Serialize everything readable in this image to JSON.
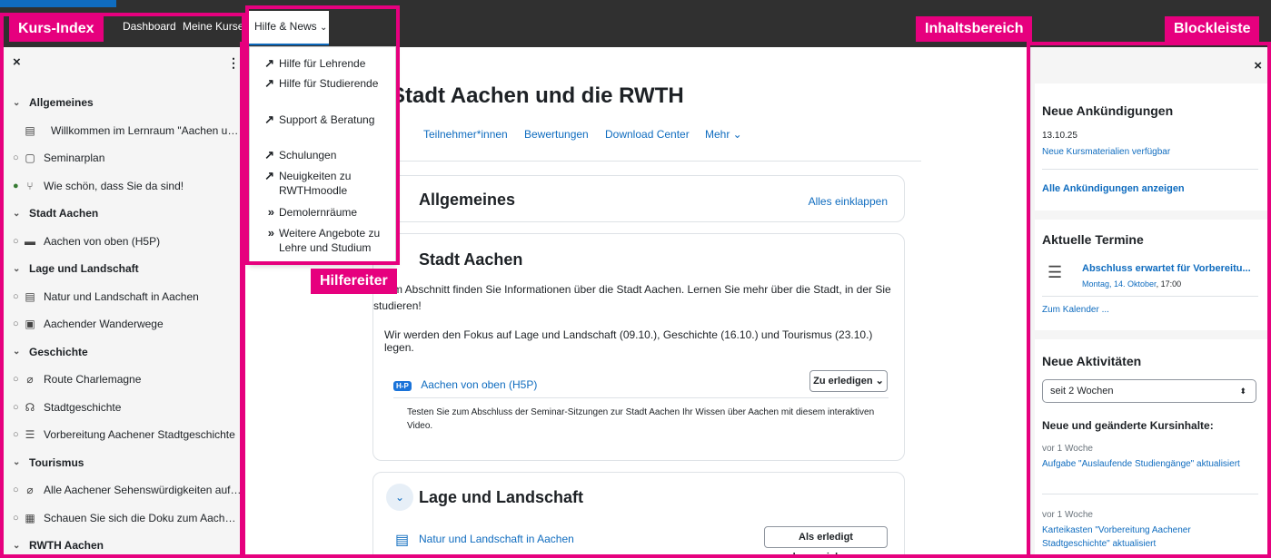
{
  "navbar": {
    "dashboard": "Dashboard",
    "my_courses": "Meine Kurse",
    "help_news": "Hilfe & News",
    "help_news_chevron": "⌄"
  },
  "annotations": {
    "course_index": "Kurs-Index",
    "content_area": "Inhaltsbereich",
    "block_drawer": "Blockleiste",
    "help_tab": "Hilfereiter"
  },
  "help_menu": {
    "items": [
      {
        "icon": "external-link-icon",
        "glyph": "↗",
        "label": "Hilfe für Lehrende"
      },
      {
        "icon": "external-link-icon",
        "glyph": "↗",
        "label": "Hilfe für Studierende"
      },
      {
        "icon": "external-link-icon",
        "glyph": "↗",
        "label": "Support & Beratung"
      },
      {
        "icon": "external-link-icon",
        "glyph": "↗",
        "label": "Schulungen"
      },
      {
        "icon": "external-link-icon",
        "glyph": "↗",
        "label": "Neuigkeiten zu RWTHmoodle"
      },
      {
        "icon": "double-chevron-right-icon",
        "glyph": "»",
        "label": "Demolernräume"
      },
      {
        "icon": "double-chevron-right-icon",
        "glyph": "»",
        "label": "Weitere Angebote zu Lehre und Studium"
      }
    ]
  },
  "course_index": {
    "close_glyph": "×",
    "menu_glyph": "⋮",
    "items": [
      {
        "kind": "section",
        "label": "Allgemeines"
      },
      {
        "kind": "activity",
        "status": "",
        "icon": "forum-icon",
        "glyph": "▤",
        "label": "Willkommen im Lernraum \"Aachen und d..."
      },
      {
        "kind": "activity",
        "status": "open",
        "icon": "file-icon",
        "glyph": "▢",
        "label": "Seminarplan"
      },
      {
        "kind": "activity",
        "status": "done",
        "icon": "choice-icon",
        "glyph": "⑂",
        "label": "Wie schön, dass Sie da sind!"
      },
      {
        "kind": "section",
        "label": "Stadt Aachen"
      },
      {
        "kind": "activity",
        "status": "open",
        "icon": "h5p-icon",
        "glyph": "▬",
        "label": "Aachen von oben (H5P)"
      },
      {
        "kind": "section",
        "label": "Lage und Landschaft"
      },
      {
        "kind": "activity",
        "status": "open",
        "icon": "page-icon",
        "glyph": "▤",
        "label": "Natur und Landschaft in Aachen"
      },
      {
        "kind": "activity",
        "status": "open",
        "icon": "assignment-icon",
        "glyph": "▣",
        "label": "Aachender Wanderwege"
      },
      {
        "kind": "section",
        "label": "Geschichte"
      },
      {
        "kind": "activity",
        "status": "open",
        "icon": "url-icon",
        "glyph": "⌀",
        "label": "Route Charlemagne"
      },
      {
        "kind": "activity",
        "status": "open",
        "icon": "wiki-icon",
        "glyph": "☊",
        "label": "Stadtgeschichte"
      },
      {
        "kind": "activity",
        "status": "open",
        "icon": "flashcard-icon",
        "glyph": "☰",
        "label": "Vorbereitung Aachener Stadtgeschichte"
      },
      {
        "kind": "section",
        "label": "Tourismus"
      },
      {
        "kind": "activity",
        "status": "open",
        "icon": "url-icon",
        "glyph": "⌀",
        "label": "Alle Aachener Sehenswürdigkeiten auf ei..."
      },
      {
        "kind": "activity",
        "status": "open",
        "icon": "video-icon",
        "glyph": "▦",
        "label": "Schauen Sie sich die Doku zum Aachener..."
      },
      {
        "kind": "section",
        "label": "RWTH Aachen"
      }
    ]
  },
  "main": {
    "course_title": "e Stadt Aachen und die RWTH",
    "tabs": [
      "Teilnehmer*innen",
      "Bewertungen",
      "Download Center",
      "Mehr ⌄"
    ],
    "sections": {
      "general": {
        "title": "Allgemeines",
        "collapse_all": "Alles einklappen"
      },
      "city": {
        "title": "Stadt Aachen",
        "intro_1": "iesem Abschnitt finden Sie Informationen über die Stadt Aachen. Lernen Sie mehr über die Stadt, in der Sie studieren!",
        "intro_2": "Wir werden den Fokus auf Lage und Landschaft (09.10.), Geschichte (16.10.) und Tourismus (23.10.) legen.",
        "activity_badge": "H-P",
        "activity_label": "Aachen von oben (H5P)",
        "todo_button": "Zu erledigen ⌄",
        "activity_desc": "Testen Sie zum Abschluss der Seminar-Sitzungen zur Stadt Aachen Ihr Wissen über Aachen mit diesem interaktiven Video."
      },
      "landscape": {
        "title": "Lage und Landschaft",
        "chevron": "⌄",
        "activity_label": "Natur und Landschaft in Aachen",
        "mark_done_button": "Als erledigt kennzeichnen"
      }
    }
  },
  "blocks": {
    "close_glyph": "×",
    "announcements": {
      "title": "Neue Ankündigungen",
      "date": "13.10.25",
      "item": "Neue Kursmaterialien verfügbar",
      "show_all": "Alle Ankündigungen anzeigen"
    },
    "events": {
      "title": "Aktuelle Termine",
      "event_title": "Abschluss erwartet für Vorbereitu...",
      "event_date_link": "Montag, 14. Oktober",
      "event_time": ", 17:00",
      "calendar_link": "Zum Kalender ..."
    },
    "recent": {
      "title": "Neue Aktivitäten",
      "select_value": "seit 2 Wochen",
      "subheading": "Neue und geänderte Kursinhalte:",
      "items": [
        {
          "when": "vor 1 Woche",
          "text": "Aufgabe \"Auslaufende Studiengänge\" aktualisiert"
        },
        {
          "when": "vor 1 Woche",
          "text": "Karteikasten \"Vorbereitung Aachener Stadtgeschichte\" aktualisiert"
        }
      ]
    }
  },
  "colors": {
    "accent": "#e6007e",
    "link": "#0f6cbf",
    "navbar": "#303030"
  }
}
